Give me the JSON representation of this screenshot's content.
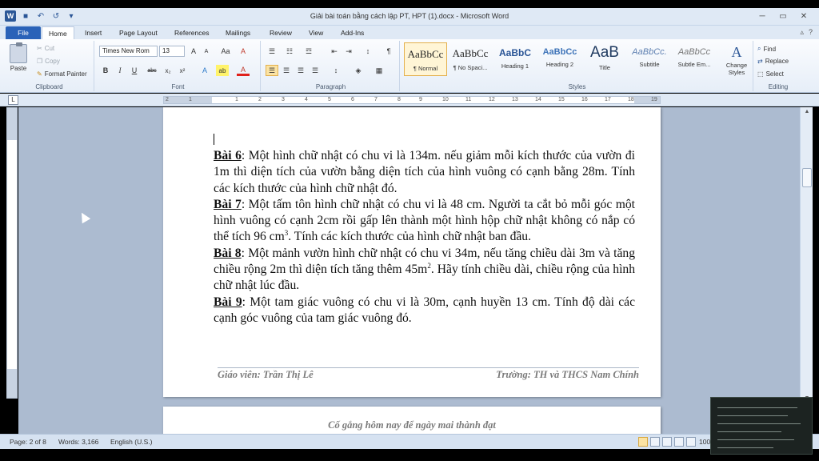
{
  "window": {
    "title": "Giải bài toán bằng cách lập PT, HPT (1).docx - Microsoft Word",
    "minimize": "─",
    "restore": "▭",
    "close": "✕"
  },
  "qat": {
    "word_icon": "W",
    "save_icon": "💾",
    "undo_icon": "↶",
    "redo_icon": "↺",
    "customize_icon": "▾"
  },
  "tabs": [
    "File",
    "Home",
    "Insert",
    "Page Layout",
    "References",
    "Mailings",
    "Review",
    "View",
    "Add-Ins"
  ],
  "tab_right": {
    "minimize_ribbon": "▵",
    "help": "?"
  },
  "ribbon": {
    "clipboard": {
      "paste": "Paste",
      "cut": "Cut",
      "copy": "Copy",
      "format_painter": "Format Painter",
      "label": "Clipboard"
    },
    "font": {
      "family": "Times New Rom",
      "size": "13",
      "grow": "A",
      "shrink": "A",
      "change_case": "Aa",
      "clear": "A",
      "bold": "B",
      "italic": "I",
      "underline": "U",
      "strike": "abc",
      "subscript": "x₂",
      "superscript": "x²",
      "text_effects": "A",
      "highlight": "ab",
      "font_color": "A",
      "label": "Font"
    },
    "paragraph": {
      "bullets": "☰",
      "numbering": "☷",
      "multilevel": "☲",
      "decrease_indent": "⇤",
      "increase_indent": "⇥",
      "sort": "↕",
      "show_marks": "¶",
      "align_left": "☰",
      "center": "☰",
      "align_right": "☰",
      "justify": "☰",
      "line_spacing": "↕",
      "shading": "◈",
      "borders": "▦",
      "label": "Paragraph"
    },
    "styles": {
      "items": [
        {
          "sample": "AaBbCc",
          "name": "¶ Normal"
        },
        {
          "sample": "AaBbCc",
          "name": "¶ No Spaci..."
        },
        {
          "sample": "AaBbC",
          "name": "Heading 1"
        },
        {
          "sample": "AaBbCc",
          "name": "Heading 2"
        },
        {
          "sample": "AaB",
          "name": "Title"
        },
        {
          "sample": "AaBbCc.",
          "name": "Subtitle"
        },
        {
          "sample": "AaBbCc",
          "name": "Subtle Em..."
        }
      ],
      "change_styles": "Change Styles",
      "label": "Styles"
    },
    "editing": {
      "find": "Find",
      "replace": "Replace",
      "select": "Select",
      "label": "Editing"
    }
  },
  "ruler": {
    "corner": "L",
    "numbers": [
      "2",
      "1",
      "1",
      "2",
      "3",
      "4",
      "5",
      "6",
      "7",
      "8",
      "9",
      "10",
      "11",
      "12",
      "13",
      "14",
      "15",
      "16",
      "17",
      "18",
      "19"
    ]
  },
  "document": {
    "paragraphs": [
      {
        "label": "Bài 6",
        "text": ": Một hình chữ nhật có chu vi là 134m. nếu giảm mỗi kích thước của vườn đi 1m thì diện tích của vườn bằng diện tích của hình vuông có cạnh bằng 28m. Tính các kích thước của hình chữ nhật đó."
      },
      {
        "label": "Bài 7",
        "text": ": Một tấm tôn hình chữ nhật có chu vi là 48 cm. Người ta cắt bỏ mỗi góc một hình vuông có cạnh 2cm rồi gấp lên thành một hình hộp chữ nhật không có nắp có thể tích 96 cm",
        "sup": "3",
        "tail": ". Tính các kích thước của hình chữ nhật ban đầu."
      },
      {
        "label": "Bài 8",
        "text": ": Một mảnh vườn hình chữ nhật có chu vi 34m, nếu tăng chiều dài 3m và tăng chiều rộng 2m thì diện tích tăng thêm 45m",
        "sup": "2",
        "tail": ". Hãy tính chiều dài, chiều rộng của hình chữ nhật lúc đầu."
      },
      {
        "label": "Bài 9",
        "text": ": Một tam giác vuông có  chu vi là 30m, cạnh huyền 13 cm. Tính độ dài các cạnh góc vuông của tam giác vuông đó."
      }
    ],
    "footer_left": "Giáo viên: Trần Thị Lê",
    "footer_right": "Trường: TH và THCS Nam Chính",
    "page2_header": "Cố gắng hôm nay để ngày mai thành đạt"
  },
  "status": {
    "page": "Page: 2 of 8",
    "words": "Words: 3,166",
    "language": "English (U.S.)",
    "zoom": "100"
  }
}
